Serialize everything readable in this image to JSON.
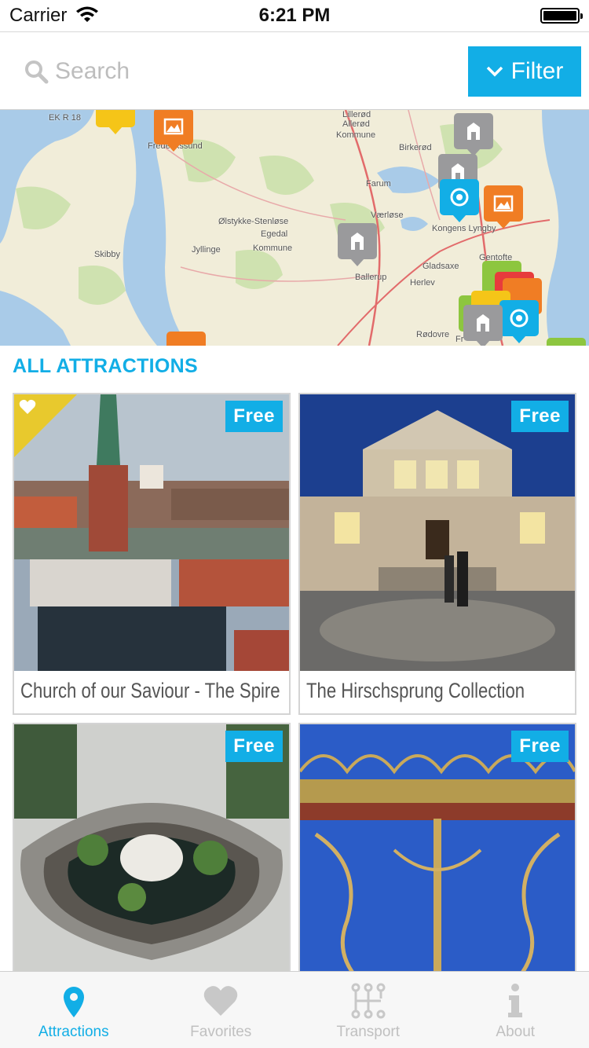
{
  "status_bar": {
    "carrier": "Carrier",
    "time": "6:21 PM"
  },
  "search": {
    "placeholder": "Search",
    "value": ""
  },
  "filter": {
    "label": "Filter"
  },
  "map": {
    "labels": [
      "EK R 18",
      "Frederikssund",
      "Lillerød",
      "Allerød",
      "Kommune",
      "Birkerød",
      "Farum",
      "Værløse",
      "Kongens Lyngby",
      "Ølstykke-Stenløse",
      "Egedal",
      "Kommune",
      "Skibby",
      "Jyllinge",
      "Ballerup",
      "Gladsaxe",
      "Herlev",
      "Gentofte",
      "Rødovre",
      "Fr"
    ]
  },
  "section": {
    "title": "ALL ATTRACTIONS"
  },
  "attractions": [
    {
      "title": "Church of our Saviour - The Spire",
      "badge": "Free",
      "favorite": true
    },
    {
      "title": "The Hirschsprung Collection",
      "badge": "Free",
      "favorite": false
    },
    {
      "title": "",
      "badge": "Free",
      "favorite": false
    },
    {
      "title": "",
      "badge": "Free",
      "favorite": false
    }
  ],
  "tabs": [
    {
      "label": "Attractions",
      "icon": "map-pin-icon",
      "active": true
    },
    {
      "label": "Favorites",
      "icon": "heart-icon",
      "active": false
    },
    {
      "label": "Transport",
      "icon": "transport-icon",
      "active": false
    },
    {
      "label": "About",
      "icon": "info-icon",
      "active": false
    }
  ],
  "colors": {
    "accent": "#12aee6",
    "favorite": "#e8c92d",
    "pin_orange": "#f07d24",
    "pin_gray": "#9a9a9c"
  }
}
